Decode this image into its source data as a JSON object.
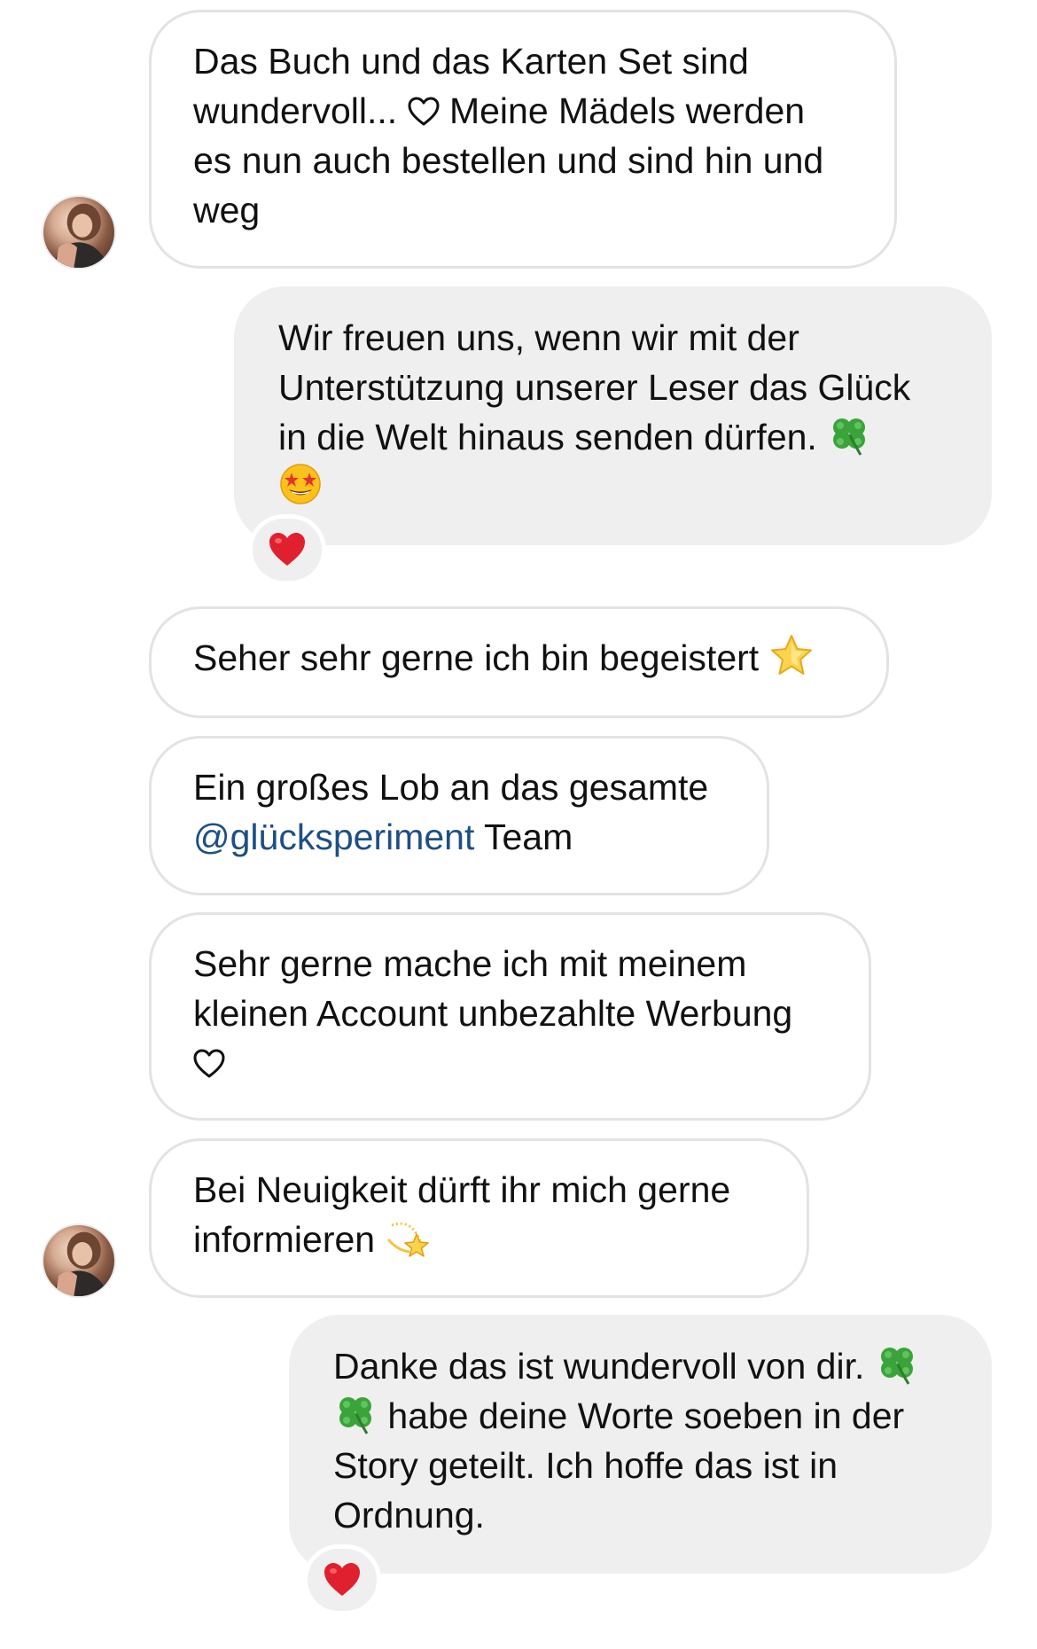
{
  "messages": [
    {
      "sender": "other",
      "text_1": "Das Buch und das Karten Set sind wundervoll... ",
      "icon": "outline-heart-icon",
      "text_2": " Meine Mädels werden es nun auch bestellen und sind hin und weg"
    },
    {
      "sender": "me",
      "text_1": "Wir freuen uns, wenn wir mit der Unterstützung unserer Leser das Glück in die Welt hinaus senden dürfen. ",
      "icons": [
        "four-leaf-clover-emoji",
        "star-struck-face-emoji"
      ],
      "reaction": "red-heart-emoji"
    },
    {
      "sender": "other",
      "text_1": "Seher sehr gerne ich bin begeistert ",
      "icon": "star-emoji"
    },
    {
      "sender": "other",
      "text_1": "Ein großes Lob an das gesamte ",
      "mention": "@glücksperiment",
      "text_2": " Team"
    },
    {
      "sender": "other",
      "text_1": "Sehr gerne mache ich mit meinem kleinen Account unbezahlte Werbung ",
      "icon": "outline-heart-icon"
    },
    {
      "sender": "other",
      "text_1": "Bei Neuigkeit dürft ihr mich gerne informieren ",
      "icon": "dizzy-star-emoji"
    },
    {
      "sender": "me",
      "text_1": "Danke das ist wundervoll von dir. ",
      "text_2": " habe deine Worte soeben in der Story geteilt. Ich hoffe das ist in Ordnung.",
      "icons": [
        "four-leaf-clover-emoji",
        "four-leaf-clover-emoji"
      ],
      "reaction": "red-heart-emoji"
    }
  ],
  "colors": {
    "received_border": "#e3e3e3",
    "sent_background": "#efefef",
    "mention": "#1d4f84",
    "reaction_heart": "#e0202e"
  }
}
